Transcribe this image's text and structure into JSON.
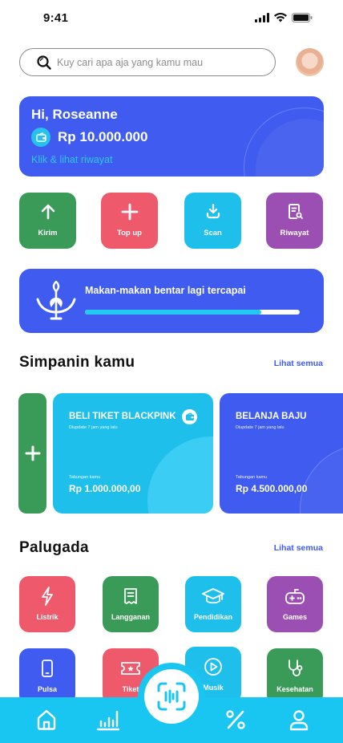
{
  "status_bar": {
    "time": "9:41"
  },
  "search": {
    "placeholder": "Kuy cari apa aja yang kamu mau"
  },
  "balance": {
    "greeting": "Hi, Roseanne",
    "amount": "Rp 10.000.000",
    "history_link": "Klik & lihat riwayat"
  },
  "quick_actions": [
    {
      "label": "Kirim",
      "icon": "arrow-up-icon",
      "color": "#3a9a58"
    },
    {
      "label": "Top up",
      "icon": "plus-icon",
      "color": "#ee5a6b"
    },
    {
      "label": "Scan",
      "icon": "download-icon",
      "color": "#1fbfec"
    },
    {
      "label": "Riwayat",
      "icon": "receipt-search-icon",
      "color": "#9c4fb3"
    }
  ],
  "goal": {
    "title": "Makan-makan bentar lagi tercapai",
    "progress": 0.82
  },
  "savings": {
    "title": "Simpanin kamu",
    "see_all": "Lihat semua",
    "items": [
      {
        "name": "BELI TIKET BLACKPINK",
        "updated": "Diupdate 7 jam yang lalu",
        "target_label": "Tabungan kamu",
        "amount": "Rp 1.000.000,00",
        "color": "#1fbfec"
      },
      {
        "name": "BELANJA BAJU",
        "updated": "Diupdate 7 jam yang lalu",
        "target_label": "Tabungan kamu",
        "amount": "Rp 4.500.000,00",
        "color": "#3f5bf0"
      }
    ]
  },
  "palugada": {
    "title": "Palugada",
    "see_all": "Lihat semua",
    "items": [
      {
        "label": "Listrik",
        "icon": "lightning-icon",
        "color": "#ee5a6b"
      },
      {
        "label": "Langganan",
        "icon": "subscription-icon",
        "color": "#3a9a58"
      },
      {
        "label": "Pendidikan",
        "icon": "graduation-cap-icon",
        "color": "#1fbfec"
      },
      {
        "label": "Games",
        "icon": "gamepad-icon",
        "color": "#9c4fb3"
      },
      {
        "label": "Pulsa",
        "icon": "phone-icon",
        "color": "#3f5bf0"
      },
      {
        "label": "Tiket",
        "icon": "ticket-icon",
        "color": "#ee5a6b"
      },
      {
        "label": "Musik",
        "icon": "play-icon",
        "color": "#1fbfec"
      },
      {
        "label": "Kesehatan",
        "icon": "stethoscope-icon",
        "color": "#3a9a58"
      }
    ]
  },
  "nav": {
    "items": [
      "home-icon",
      "chart-icon",
      "scan-icon",
      "percent-icon",
      "profile-icon"
    ],
    "color": "#19c6f2"
  }
}
